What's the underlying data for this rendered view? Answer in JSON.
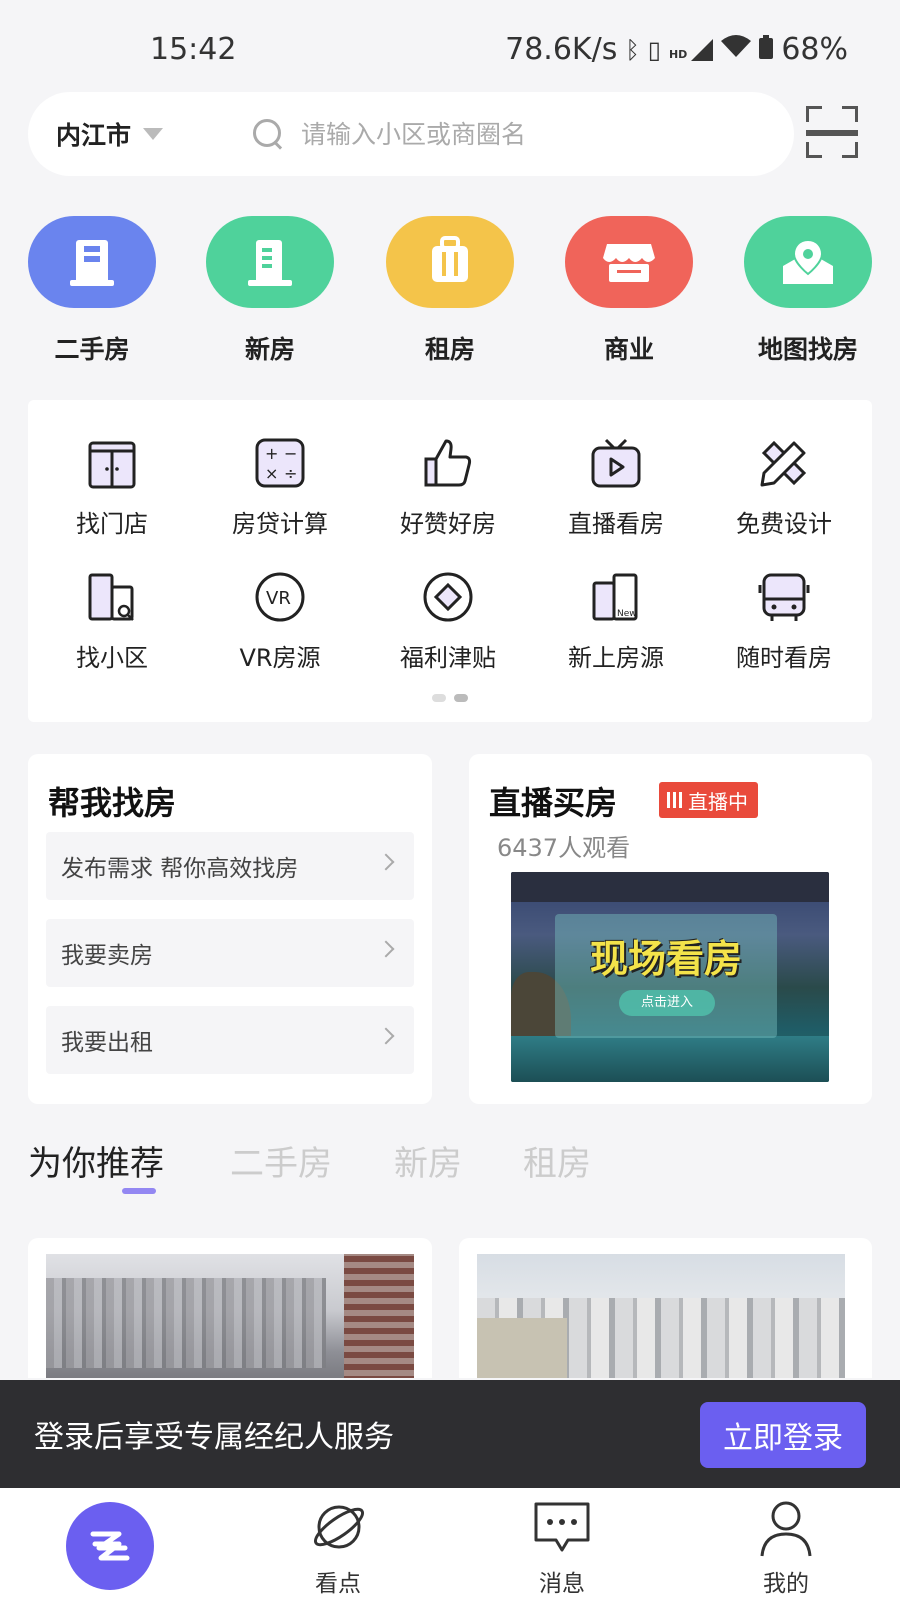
{
  "status_bar": {
    "time": "15:42",
    "network_speed": "78.6K/s",
    "signal_label": "HD",
    "battery": "68%"
  },
  "search": {
    "city": "内江市",
    "placeholder": "请输入小区或商圈名"
  },
  "main_categories": [
    {
      "label": "二手房",
      "color": "#6a84ee",
      "icon": "building-icon"
    },
    {
      "label": "新房",
      "color": "#4fd29b",
      "icon": "new-building-icon"
    },
    {
      "label": "租房",
      "color": "#f4c44a",
      "icon": "suitcase-icon"
    },
    {
      "label": "商业",
      "color": "#f0645a",
      "icon": "store-icon"
    },
    {
      "label": "地图找房",
      "color": "#4fd29b",
      "icon": "map-pin-icon"
    }
  ],
  "quick_tools": [
    {
      "label": "找门店",
      "icon": "store-door-icon"
    },
    {
      "label": "房贷计算",
      "icon": "calculator-icon"
    },
    {
      "label": "好赞好房",
      "icon": "thumbs-up-icon"
    },
    {
      "label": "直播看房",
      "icon": "tv-play-icon"
    },
    {
      "label": "免费设计",
      "icon": "ruler-pencil-icon"
    },
    {
      "label": "找小区",
      "icon": "community-search-icon"
    },
    {
      "label": "VR房源",
      "icon": "vr-icon"
    },
    {
      "label": "福利津贴",
      "icon": "diamond-coin-icon"
    },
    {
      "label": "新上房源",
      "icon": "new-listing-icon"
    },
    {
      "label": "随时看房",
      "icon": "bus-icon"
    }
  ],
  "help_card": {
    "title": "帮我找房",
    "links": [
      "发布需求 帮你高效找房",
      "我要卖房",
      "我要出租"
    ]
  },
  "live_card": {
    "title": "直播买房",
    "badge": "直播中",
    "viewers": "6437人观看",
    "banner_title": "现场看房",
    "banner_button": "点击进入"
  },
  "recommend_tabs": [
    {
      "label": "为你推荐",
      "active": true
    },
    {
      "label": "二手房",
      "active": false
    },
    {
      "label": "新房",
      "active": false
    },
    {
      "label": "租房",
      "active": false
    }
  ],
  "login_banner": {
    "text": "登录后享受专属经纪人服务",
    "button": "立即登录"
  },
  "bottom_nav": [
    {
      "label": "",
      "icon": "home-logo-icon",
      "active": true
    },
    {
      "label": "看点",
      "icon": "planet-icon"
    },
    {
      "label": "消息",
      "icon": "message-icon"
    },
    {
      "label": "我的",
      "icon": "user-icon"
    }
  ],
  "colors": {
    "accent": "#6b5ff0",
    "live_red": "#e94a3b",
    "banner_bg": "#2e2e31"
  }
}
